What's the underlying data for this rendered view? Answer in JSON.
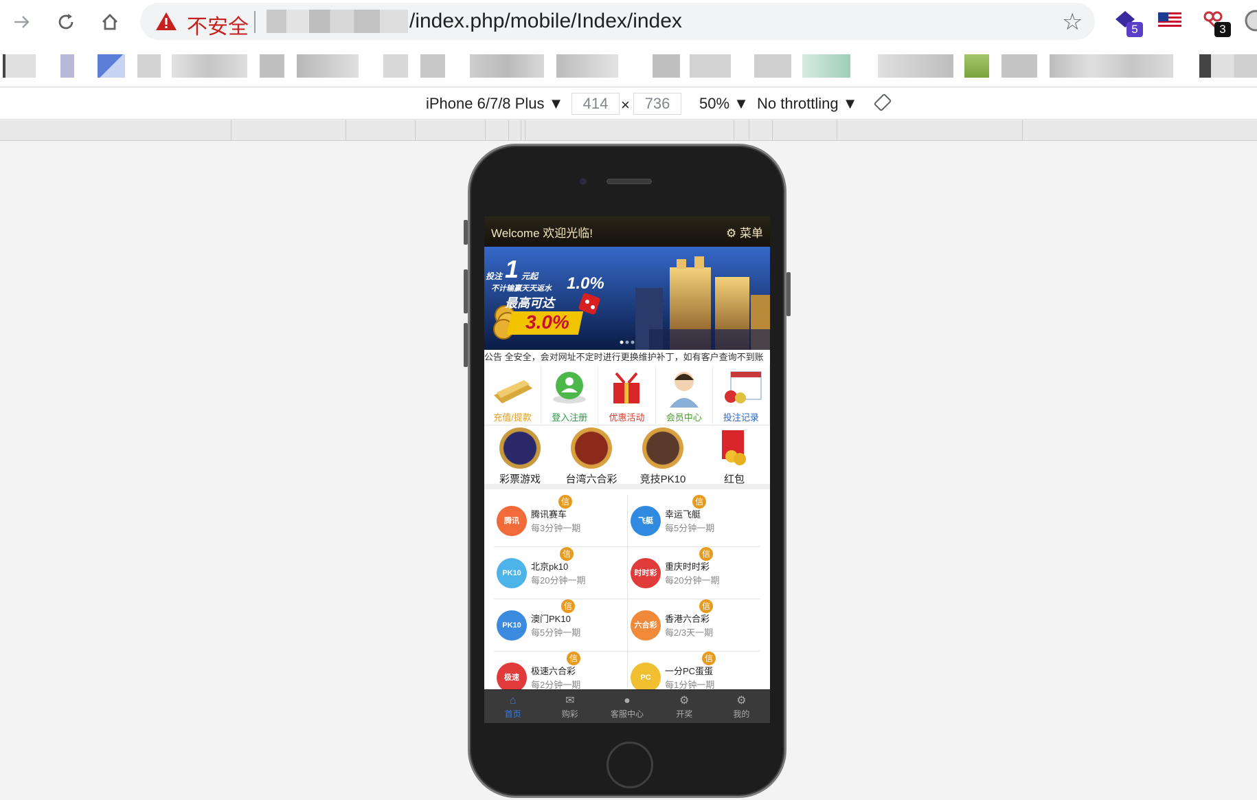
{
  "browser": {
    "security_label": "不安全",
    "url_path": "/index.php/mobile/Index/index",
    "extension_badges": [
      "5",
      "3"
    ]
  },
  "devtools": {
    "device": "iPhone 6/7/8 Plus ▼",
    "width": "414",
    "times": "×",
    "height": "736",
    "zoom": "50% ▼",
    "throttling": "No throttling ▼"
  },
  "app": {
    "welcome": "Welcome 欢迎光临!",
    "menu_label": "菜单",
    "banner": {
      "line1": "投注",
      "big_one": "1",
      "yuan": "元起",
      "line2": "不计输赢天天返水",
      "rate1": "1.0%",
      "line3": "最高可达",
      "rate2": "3.0%"
    },
    "notice": "公告 全安全，会对网址不定时进行更换维护补丁，如有客户查询不到账",
    "shortcuts": [
      {
        "label": "充值/提款",
        "color": "#e0a020"
      },
      {
        "label": "登入注册",
        "color": "#2e9a48"
      },
      {
        "label": "优惠活动",
        "color": "#d83a2a"
      },
      {
        "label": "会员中心",
        "color": "#4aa02a"
      },
      {
        "label": "投注记录",
        "color": "#2a64c8"
      }
    ],
    "games": [
      {
        "label": "彩票游戏",
        "icon_text": "彩票游戏"
      },
      {
        "label": "台湾六合彩",
        "icon_text": "六合彩"
      },
      {
        "label": "竞技PK10",
        "icon_text": "PK10"
      },
      {
        "label": "红包",
        "icon_text": "红包"
      }
    ],
    "credit_badge": "信",
    "lotteries": [
      [
        {
          "name": "腾讯赛车",
          "period": "每3分钟一期",
          "icon": "腾讯",
          "color": "#f06a3a"
        },
        {
          "name": "幸运飞艇",
          "period": "每5分钟一期",
          "icon": "飞艇",
          "color": "#2f8ae0"
        }
      ],
      [
        {
          "name": "北京pk10",
          "period": "每20分钟一期",
          "icon": "PK10",
          "color": "#4db4ea"
        },
        {
          "name": "重庆时时彩",
          "period": "每20分钟一期",
          "icon": "时时彩",
          "color": "#e03a3a"
        }
      ],
      [
        {
          "name": "澳门PK10",
          "period": "每5分钟一期",
          "icon": "PK10",
          "color": "#3a8ae0"
        },
        {
          "name": "香港六合彩",
          "period": "每2/3天一期",
          "icon": "六合彩",
          "color": "#f08a3a"
        }
      ],
      [
        {
          "name": "极速六合彩",
          "period": "每2分钟一期",
          "icon": "极速",
          "color": "#e03a3a"
        },
        {
          "name": "一分PC蛋蛋",
          "period": "每1分钟一期",
          "icon": "PC",
          "color": "#f0c030"
        }
      ]
    ],
    "tabs": [
      {
        "label": "首页",
        "icon": "⌂"
      },
      {
        "label": "购彩",
        "icon": "✉"
      },
      {
        "label": "客服中心",
        "icon": "●"
      },
      {
        "label": "开奖",
        "icon": "⚙"
      },
      {
        "label": "我的",
        "icon": "⚙"
      }
    ]
  }
}
